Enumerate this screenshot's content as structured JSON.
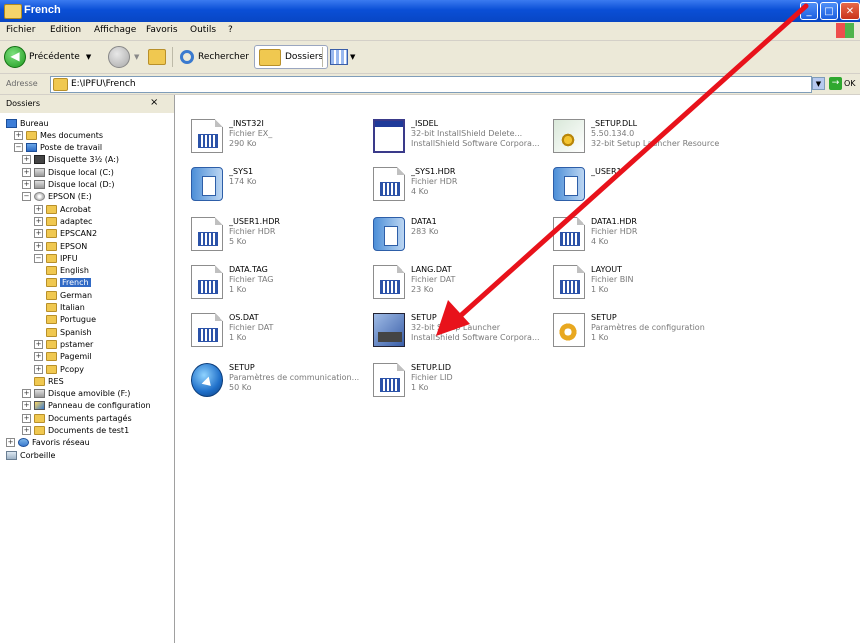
{
  "window": {
    "title": "French"
  },
  "titlebar_buttons": {
    "minimize": "_",
    "maximize": "□",
    "close": "✕"
  },
  "menu": [
    "Fichier",
    "Edition",
    "Affichage",
    "Favoris",
    "Outils",
    "?"
  ],
  "toolbar": {
    "back_label": "Précédente",
    "search_label": "Rechercher",
    "folders_label": "Dossiers"
  },
  "address": {
    "label": "Adresse",
    "value": "E:\\IPFU\\French",
    "go_label": "OK"
  },
  "folders_pane": {
    "title": "Dossiers",
    "close": "×",
    "tree": [
      {
        "label": "Bureau",
        "icon": "desktop-icon",
        "expander": ""
      },
      {
        "label": "Mes documents",
        "icon": "folder-icon",
        "expander": "+"
      },
      {
        "label": "Poste de travail",
        "icon": "computer-icon",
        "expander": "−"
      },
      {
        "label": "Disquette 3½ (A:)",
        "icon": "floppy-icon",
        "expander": "+"
      },
      {
        "label": "Disque local (C:)",
        "icon": "drive-icon",
        "expander": "+"
      },
      {
        "label": "Disque local (D:)",
        "icon": "drive-icon",
        "expander": "+"
      },
      {
        "label": "EPSON (E:)",
        "icon": "cd-icon",
        "expander": "−"
      },
      {
        "label": "Acrobat",
        "icon": "folder-icon",
        "expander": "+"
      },
      {
        "label": "adaptec",
        "icon": "folder-icon",
        "expander": "+"
      },
      {
        "label": "EPSCAN2",
        "icon": "folder-icon",
        "expander": "+"
      },
      {
        "label": "EPSON",
        "icon": "folder-icon",
        "expander": "+"
      },
      {
        "label": "IPFU",
        "icon": "folder-icon",
        "expander": "−"
      },
      {
        "label": "English",
        "icon": "folder-icon",
        "expander": ""
      },
      {
        "label": "French",
        "icon": "folder-icon",
        "expander": "",
        "selected": true
      },
      {
        "label": "German",
        "icon": "folder-icon",
        "expander": ""
      },
      {
        "label": "Italian",
        "icon": "folder-icon",
        "expander": ""
      },
      {
        "label": "Portugue",
        "icon": "folder-icon",
        "expander": ""
      },
      {
        "label": "Spanish",
        "icon": "folder-icon",
        "expander": ""
      },
      {
        "label": "pstamer",
        "icon": "folder-icon",
        "expander": "+"
      },
      {
        "label": "Pagemil",
        "icon": "folder-icon",
        "expander": "+"
      },
      {
        "label": "Pcopy",
        "icon": "folder-icon",
        "expander": "+"
      },
      {
        "label": "RES",
        "icon": "folder-icon",
        "expander": ""
      },
      {
        "label": "Disque amovible (F:)",
        "icon": "drive-icon",
        "expander": "+"
      },
      {
        "label": "Panneau de configuration",
        "icon": "control-panel-icon",
        "expander": "+"
      },
      {
        "label": "Documents partagés",
        "icon": "folder-icon",
        "expander": "+"
      },
      {
        "label": "Documents de test1",
        "icon": "folder-icon",
        "expander": "+"
      },
      {
        "label": "Favoris réseau",
        "icon": "network-icon",
        "expander": "+"
      },
      {
        "label": "Corbeille",
        "icon": "recycle-bin-icon",
        "expander": ""
      }
    ]
  },
  "files": [
    {
      "name": "_INST32I",
      "line1": "Fichier EX_",
      "line2": "290 Ko",
      "icon": "doc"
    },
    {
      "name": "_ISDEL",
      "line1": "32-bit InstallShield Delete...",
      "line2": "InstallShield Software Corpora...",
      "icon": "win"
    },
    {
      "name": "_SETUP.DLL",
      "line1": "5.50.134.0",
      "line2": "32-bit Setup Launcher Resource",
      "icon": "dll"
    },
    {
      "name": "_SYS1",
      "line1": "174 Ko",
      "line2": "",
      "icon": "cab"
    },
    {
      "name": "_SYS1.HDR",
      "line1": "Fichier HDR",
      "line2": "4 Ko",
      "icon": "doc"
    },
    {
      "name": "_USER1",
      "line1": "",
      "line2": "",
      "icon": "cab"
    },
    {
      "name": "_USER1.HDR",
      "line1": "Fichier HDR",
      "line2": "5 Ko",
      "icon": "doc"
    },
    {
      "name": "DATA1",
      "line1": "283 Ko",
      "line2": "",
      "icon": "cab"
    },
    {
      "name": "DATA1.HDR",
      "line1": "Fichier HDR",
      "line2": "4 Ko",
      "icon": "doc"
    },
    {
      "name": "DATA.TAG",
      "line1": "Fichier TAG",
      "line2": "1 Ko",
      "icon": "doc"
    },
    {
      "name": "LANG.DAT",
      "line1": "Fichier DAT",
      "line2": "23 Ko",
      "icon": "doc"
    },
    {
      "name": "LAYOUT",
      "line1": "Fichier BIN",
      "line2": "1 Ko",
      "icon": "doc"
    },
    {
      "name": "OS.DAT",
      "line1": "Fichier DAT",
      "line2": "1 Ko",
      "icon": "doc"
    },
    {
      "name": "SETUP",
      "line1": "32-bit Setup Launcher",
      "line2": "InstallShield Software Corpora...",
      "icon": "setup"
    },
    {
      "name": "SETUP",
      "line1": "Paramètres de configuration",
      "line2": "1 Ko",
      "icon": "cfg"
    },
    {
      "name": "SETUP",
      "line1": "Paramètres de communication...",
      "line2": "50 Ko",
      "icon": "globe"
    },
    {
      "name": "SETUP.LID",
      "line1": "Fichier LID",
      "line2": "1 Ko",
      "icon": "doc"
    }
  ],
  "colors": {
    "annotation_arrow": "#e8121b",
    "selection": "#316ac5",
    "titlebar": "#0a4fd6"
  }
}
